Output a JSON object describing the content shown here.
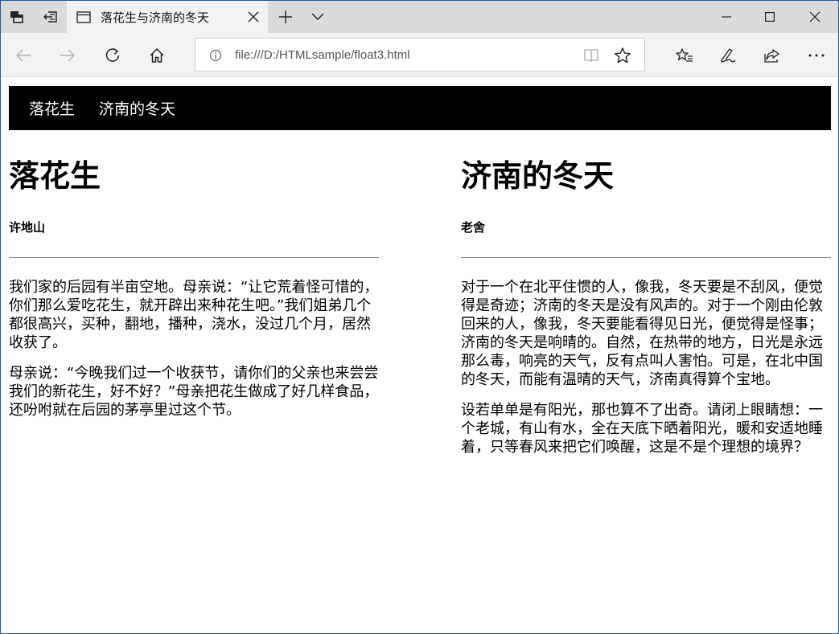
{
  "browser": {
    "tab_title": "落花生与济南的冬天",
    "url": "file:///D:/HTMLsample/float3.html"
  },
  "nav": {
    "items": [
      "落花生",
      "济南的冬天"
    ]
  },
  "articles": [
    {
      "title": "落花生",
      "author": "许地山",
      "paragraphs": [
        "我们家的后园有半亩空地。母亲说：“让它荒着怪可惜的，你们那么爱吃花生，就开辟出来种花生吧。”我们姐弟几个都很高兴，买种，翻地，播种，浇水，没过几个月，居然收获了。",
        "母亲说：“今晚我们过一个收获节，请你们的父亲也来尝尝我们的新花生，好不好？”母亲把花生做成了好几样食品，还吩咐就在后园的茅亭里过这个节。"
      ]
    },
    {
      "title": "济南的冬天",
      "author": "老舍",
      "paragraphs": [
        "对于一个在北平住惯的人，像我，冬天要是不刮风，便觉得是奇迹；济南的冬天是没有风声的。对于一个刚由伦敦回来的人，像我，冬天要能看得见日光，便觉得是怪事；济南的冬天是响晴的。自然，在热带的地方，日光是永远那么毒，响亮的天气，反有点叫人害怕。可是，在北中国的冬天，而能有温晴的天气，济南真得算个宝地。",
        "设若单单是有阳光，那也算不了出奇。请闭上眼睛想：一个老城，有山有水，全在天底下晒着阳光，暖和安适地睡着，只等春风来把它们唤醒，这是不是个理想的境界？"
      ]
    }
  ]
}
